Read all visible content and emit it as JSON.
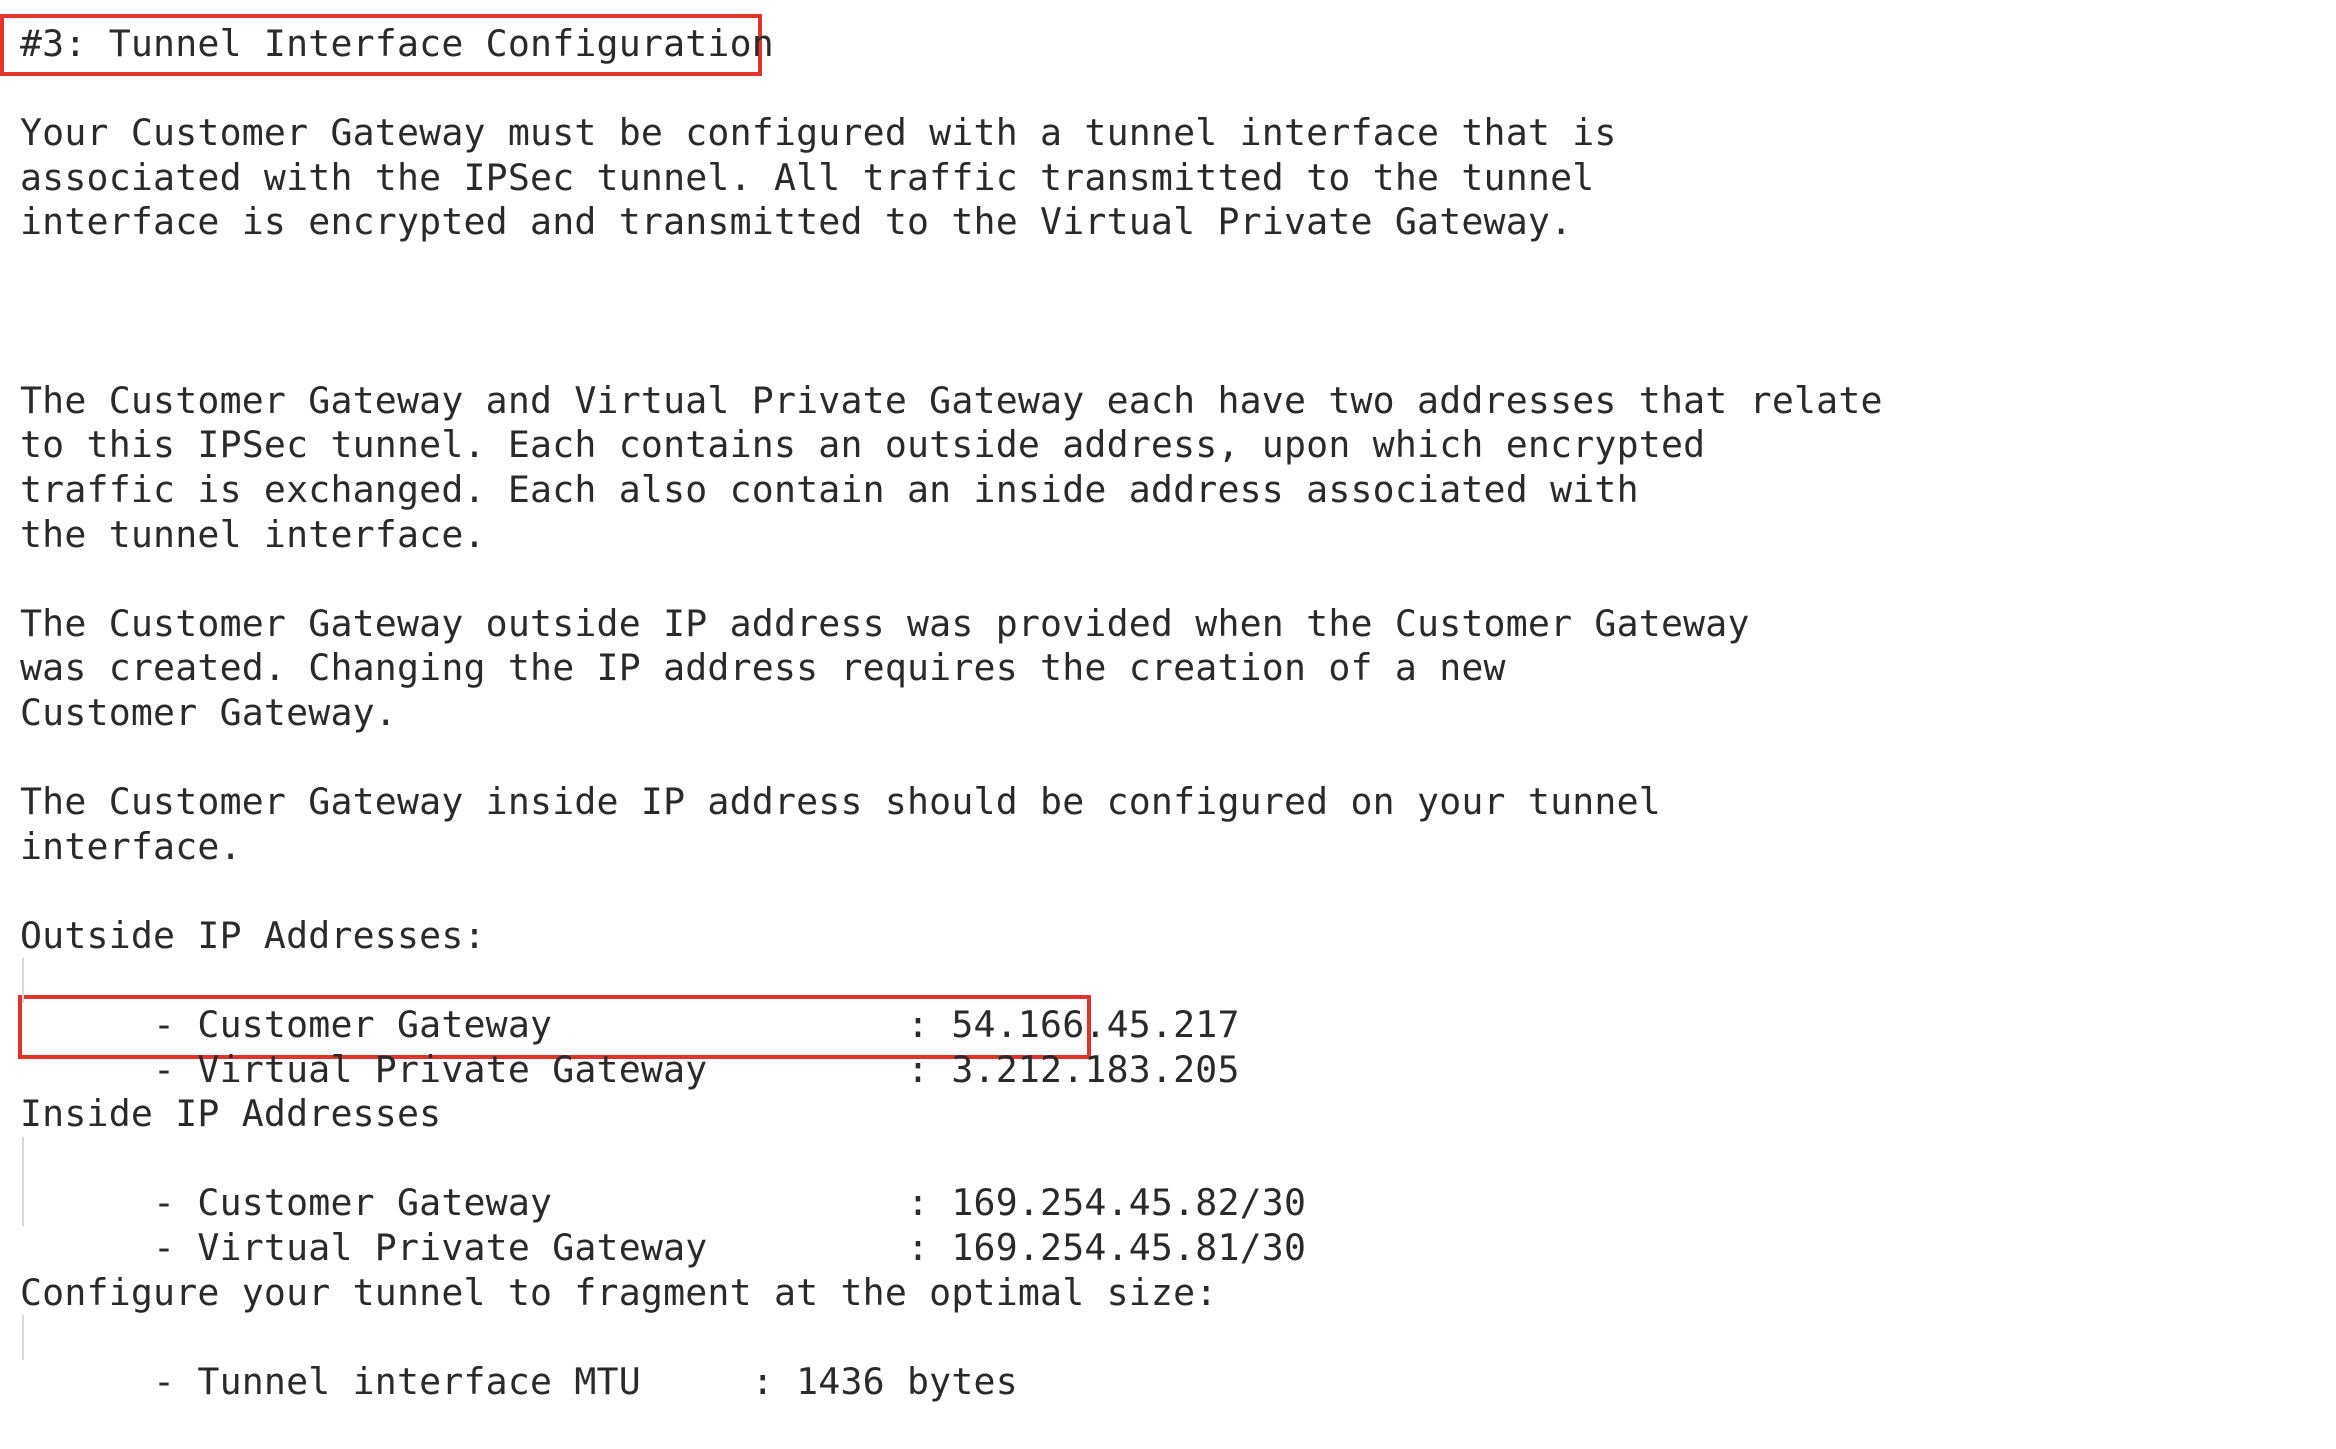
{
  "title": "#3: Tunnel Interface Configuration",
  "intro": [
    "Your Customer Gateway must be configured with a tunnel interface that is",
    "associated with the IPSec tunnel. All traffic transmitted to the tunnel",
    "interface is encrypted and transmitted to the Virtual Private Gateway."
  ],
  "para_addresses": [
    "The Customer Gateway and Virtual Private Gateway each have two addresses that relate",
    "to this IPSec tunnel. Each contains an outside address, upon which encrypted",
    "traffic is exchanged. Each also contain an inside address associated with",
    "the tunnel interface."
  ],
  "para_outside": [
    "The Customer Gateway outside IP address was provided when the Customer Gateway",
    "was created. Changing the IP address requires the creation of a new",
    "Customer Gateway."
  ],
  "para_inside": [
    "The Customer Gateway inside IP address should be configured on your tunnel",
    "interface."
  ],
  "outside": {
    "heading": "Outside IP Addresses:",
    "customer_gateway": "  - Customer Gateway                : 54.166.45.217",
    "virtual_private_gateway": "  - Virtual Private Gateway         : 3.212.183.205"
  },
  "inside": {
    "heading": "Inside IP Addresses",
    "customer_gateway": "  - Customer Gateway                : 169.254.45.82/30",
    "virtual_private_gateway": "  - Virtual Private Gateway         : 169.254.45.81/30"
  },
  "mtu": {
    "heading": "Configure your tunnel to fragment at the optimal size:",
    "item": "  - Tunnel interface MTU     : 1436 bytes"
  },
  "colors": {
    "highlight_border": "#e0332b",
    "text": "#2a2a2a"
  }
}
